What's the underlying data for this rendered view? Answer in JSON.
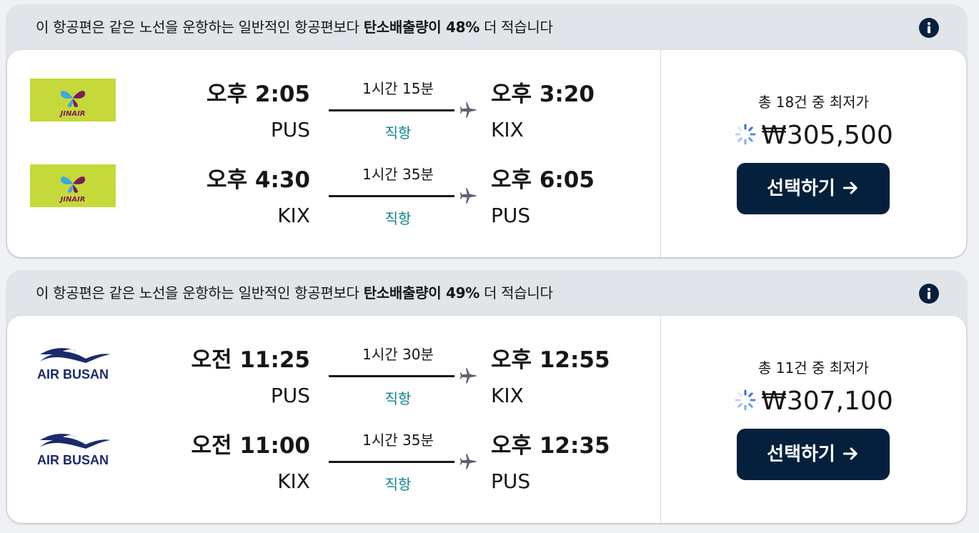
{
  "results": [
    {
      "eco": {
        "prefix": "이 항공편은 같은 노선을 운항하는 일반적인 항공편보다 ",
        "bold": "탄소배출량이 48%",
        "suffix": " 더 적습니다"
      },
      "legs": [
        {
          "airline_logo": "jinair-logo",
          "dep_time": "오후 2:05",
          "dep_code": "PUS",
          "duration": "1시간 15분",
          "stops": "직항",
          "arr_time": "오후 3:20",
          "arr_code": "KIX"
        },
        {
          "airline_logo": "jinair-logo",
          "dep_time": "오후 4:30",
          "dep_code": "KIX",
          "duration": "1시간 35분",
          "stops": "직항",
          "arr_time": "오후 6:05",
          "arr_code": "PUS"
        }
      ],
      "deals": "총 18건 중 최저가",
      "price": "₩305,500",
      "select_label": "선택하기"
    },
    {
      "eco": {
        "prefix": "이 항공편은 같은 노선을 운항하는 일반적인 항공편보다 ",
        "bold": "탄소배출량이 49%",
        "suffix": " 더 적습니다"
      },
      "legs": [
        {
          "airline_logo": "airbusan-logo",
          "dep_time": "오전 11:25",
          "dep_code": "PUS",
          "duration": "1시간 30분",
          "stops": "직항",
          "arr_time": "오후 12:55",
          "arr_code": "KIX"
        },
        {
          "airline_logo": "airbusan-logo",
          "dep_time": "오전 11:00",
          "dep_code": "KIX",
          "duration": "1시간 35분",
          "stops": "직항",
          "arr_time": "오후 12:35",
          "arr_code": "PUS"
        }
      ],
      "deals": "총 11건 중 최저가",
      "price": "₩307,100",
      "select_label": "선택하기"
    }
  ],
  "logo_text": {
    "jinair": "JINAIR",
    "airbusan": "AIR BUSAN"
  },
  "colors": {
    "button": "#05203c",
    "direct": "#0c838a",
    "jinair_bg": "#c6d93a",
    "airbusan": "#1b2a6b"
  }
}
